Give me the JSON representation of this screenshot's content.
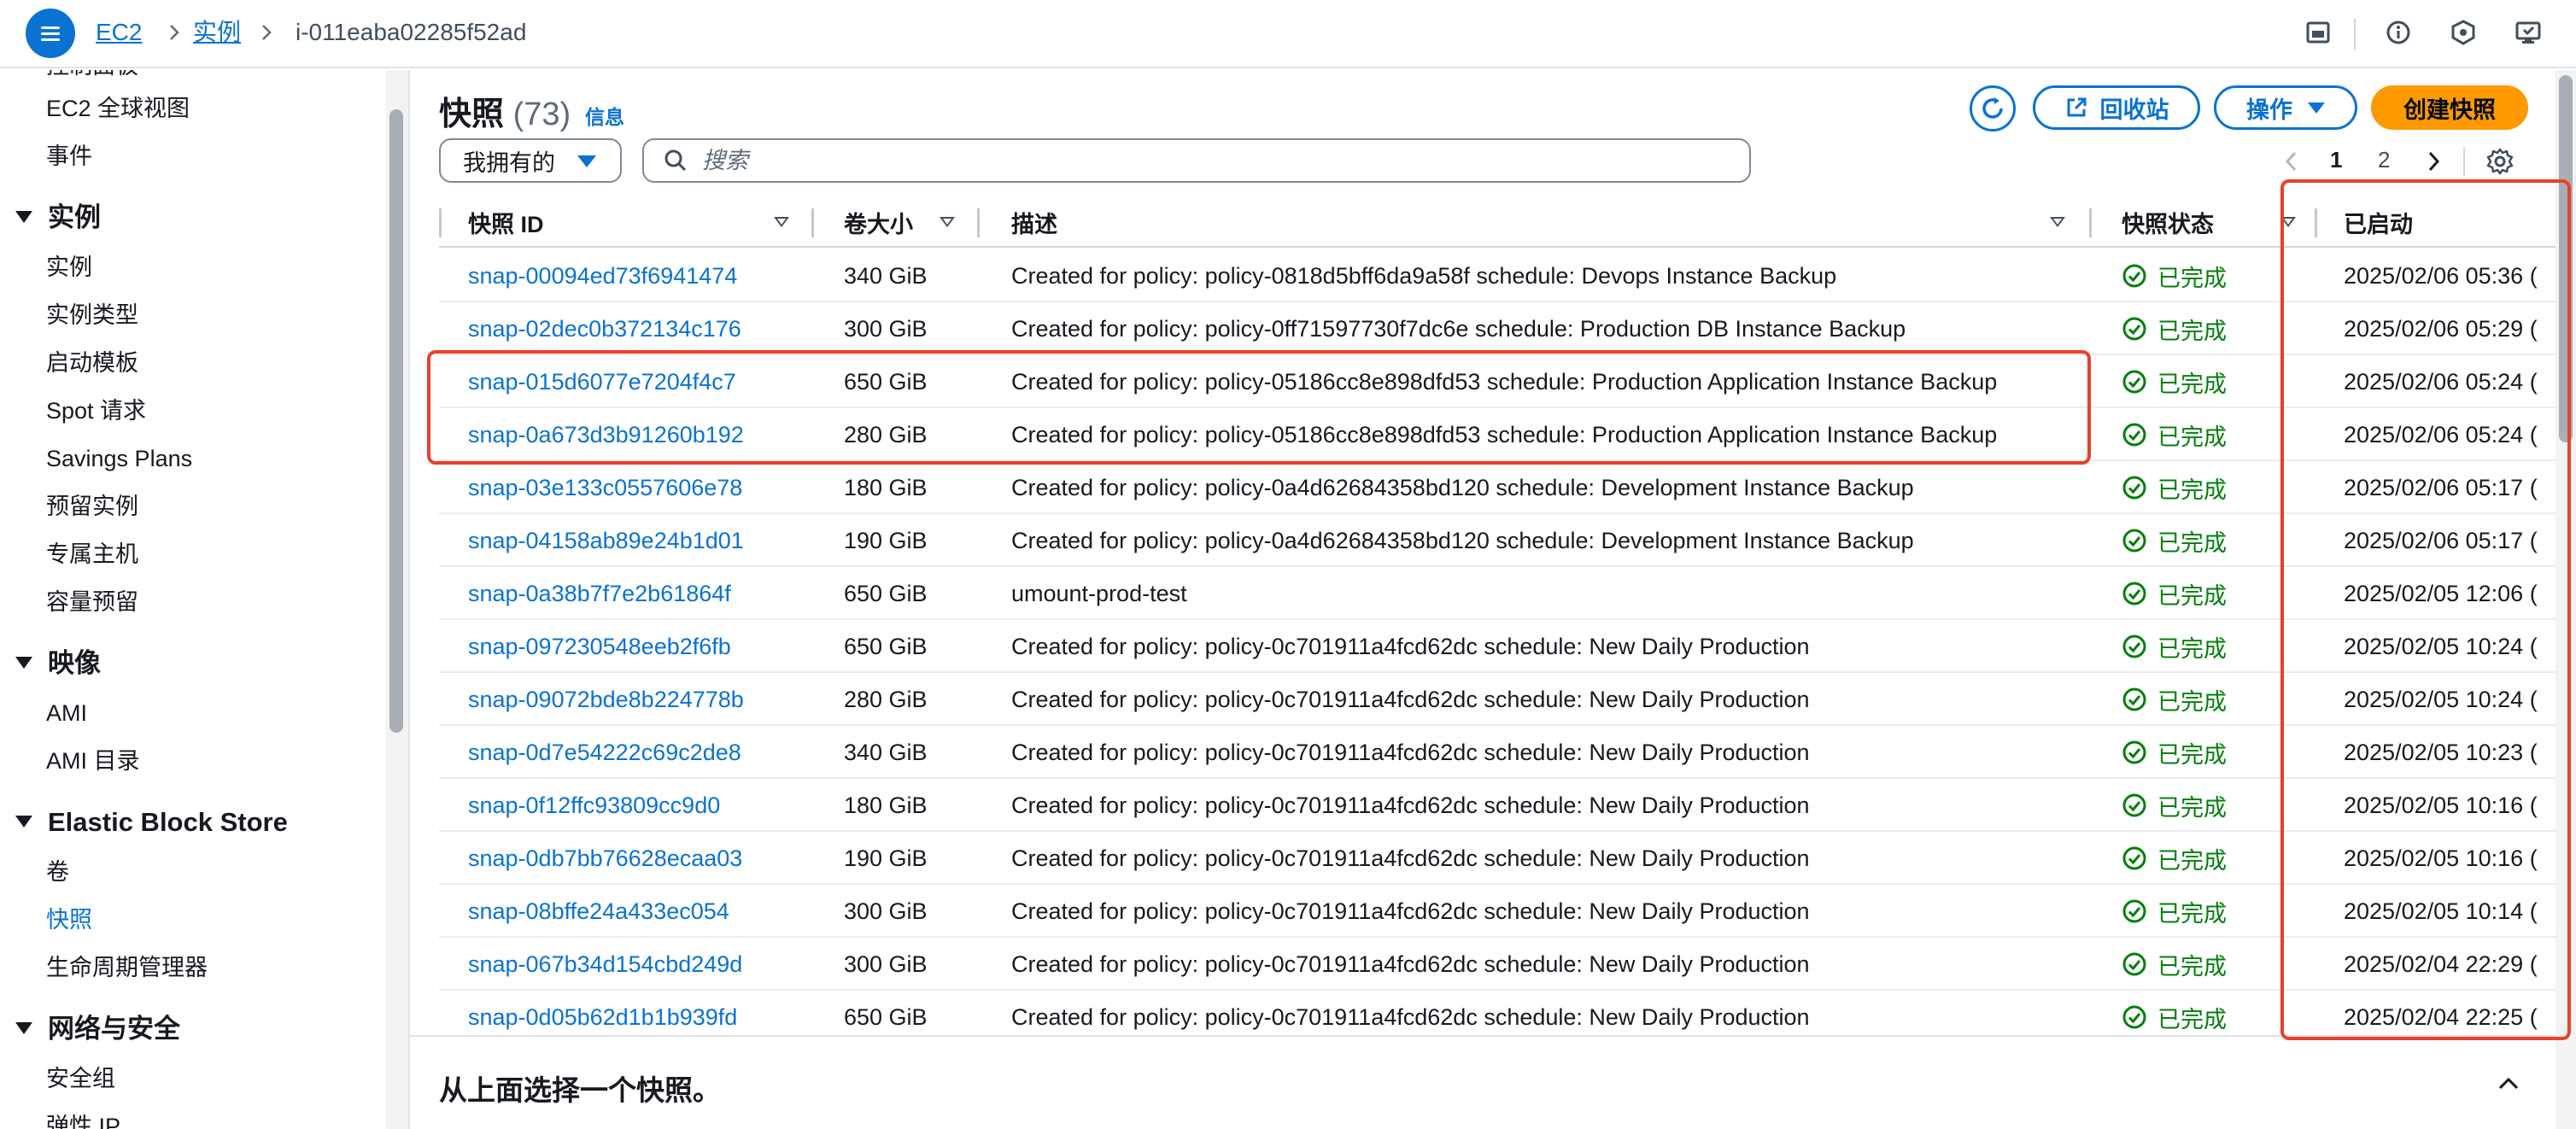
{
  "breadcrumb": {
    "items": [
      "EC2",
      "实例"
    ],
    "current": "i-011eaba02285f52ad"
  },
  "sidebar": {
    "partial_top": "控制面板",
    "items_top": [
      "EC2 全球视图",
      "事件"
    ],
    "sections": [
      {
        "title": "实例",
        "items": [
          "实例",
          "实例类型",
          "启动模板",
          "Spot 请求",
          "Savings Plans",
          "预留实例",
          "专属主机",
          "容量预留"
        ]
      },
      {
        "title": "映像",
        "items": [
          "AMI",
          "AMI 目录"
        ]
      },
      {
        "title": "Elastic Block Store",
        "items": [
          "卷",
          "快照",
          "生命周期管理器"
        ]
      },
      {
        "title": "网络与安全",
        "items": [
          "安全组",
          "弹性 IP"
        ]
      }
    ],
    "active_item": "快照"
  },
  "header": {
    "title": "快照",
    "count": "(73)",
    "info_link": "信息",
    "refresh_icon": "refresh-icon",
    "recycle_bin_button": "回收站",
    "actions_button": "操作",
    "create_button": "创建快照"
  },
  "filter": {
    "owner_select": "我拥有的",
    "search_placeholder": "搜索"
  },
  "pagination": {
    "pages": [
      "1",
      "2"
    ],
    "current": "1"
  },
  "table": {
    "columns": [
      "快照 ID",
      "卷大小",
      "描述",
      "快照状态",
      "已启动"
    ],
    "rows": [
      {
        "id": "snap-00094ed73f6941474",
        "size": "340 GiB",
        "description": "Created for policy: policy-0818d5bff6da9a58f schedule: Devops Instance Backup",
        "status": "已完成",
        "started": "2025/02/06 05:36 ("
      },
      {
        "id": "snap-02dec0b372134c176",
        "size": "300 GiB",
        "description": "Created for policy: policy-0ff71597730f7dc6e schedule: Production DB Instance Backup",
        "status": "已完成",
        "started": "2025/02/06 05:29 ("
      },
      {
        "id": "snap-015d6077e7204f4c7",
        "size": "650 GiB",
        "description": "Created for policy: policy-05186cc8e898dfd53 schedule: Production Application Instance Backup",
        "status": "已完成",
        "started": "2025/02/06 05:24 ("
      },
      {
        "id": "snap-0a673d3b91260b192",
        "size": "280 GiB",
        "description": "Created for policy: policy-05186cc8e898dfd53 schedule: Production Application Instance Backup",
        "status": "已完成",
        "started": "2025/02/06 05:24 ("
      },
      {
        "id": "snap-03e133c0557606e78",
        "size": "180 GiB",
        "description": "Created for policy: policy-0a4d62684358bd120 schedule: Development Instance Backup",
        "status": "已完成",
        "started": "2025/02/06 05:17 ("
      },
      {
        "id": "snap-04158ab89e24b1d01",
        "size": "190 GiB",
        "description": "Created for policy: policy-0a4d62684358bd120 schedule: Development Instance Backup",
        "status": "已完成",
        "started": "2025/02/06 05:17 ("
      },
      {
        "id": "snap-0a38b7f7e2b61864f",
        "size": "650 GiB",
        "description": "umount-prod-test",
        "status": "已完成",
        "started": "2025/02/05 12:06 ("
      },
      {
        "id": "snap-097230548eeb2f6fb",
        "size": "650 GiB",
        "description": "Created for policy: policy-0c701911a4fcd62dc schedule: New Daily Production",
        "status": "已完成",
        "started": "2025/02/05 10:24 ("
      },
      {
        "id": "snap-09072bde8b224778b",
        "size": "280 GiB",
        "description": "Created for policy: policy-0c701911a4fcd62dc schedule: New Daily Production",
        "status": "已完成",
        "started": "2025/02/05 10:24 ("
      },
      {
        "id": "snap-0d7e54222c69c2de8",
        "size": "340 GiB",
        "description": "Created for policy: policy-0c701911a4fcd62dc schedule: New Daily Production",
        "status": "已完成",
        "started": "2025/02/05 10:23 ("
      },
      {
        "id": "snap-0f12ffc93809cc9d0",
        "size": "180 GiB",
        "description": "Created for policy: policy-0c701911a4fcd62dc schedule: New Daily Production",
        "status": "已完成",
        "started": "2025/02/05 10:16 ("
      },
      {
        "id": "snap-0db7bb76628ecaa03",
        "size": "190 GiB",
        "description": "Created for policy: policy-0c701911a4fcd62dc schedule: New Daily Production",
        "status": "已完成",
        "started": "2025/02/05 10:16 ("
      },
      {
        "id": "snap-08bffe24a433ec054",
        "size": "300 GiB",
        "description": "Created for policy: policy-0c701911a4fcd62dc schedule: New Daily Production",
        "status": "已完成",
        "started": "2025/02/05 10:14 ("
      },
      {
        "id": "snap-067b34d154cbd249d",
        "size": "300 GiB",
        "description": "Created for policy: policy-0c701911a4fcd62dc schedule: New Daily Production",
        "status": "已完成",
        "started": "2025/02/04 22:29 ("
      },
      {
        "id": "snap-0d05b62d1b1b939fd",
        "size": "650 GiB",
        "description": "Created for policy: policy-0c701911a4fcd62dc schedule: New Daily Production",
        "status": "已完成",
        "started": "2025/02/04 22:25 ("
      }
    ]
  },
  "bottom_panel": {
    "title": "从上面选择一个快照。"
  },
  "colors": {
    "link": "#0972d3",
    "success": "#037f0c",
    "primary_button": "#ff9900",
    "annotation": "#e8412c"
  }
}
